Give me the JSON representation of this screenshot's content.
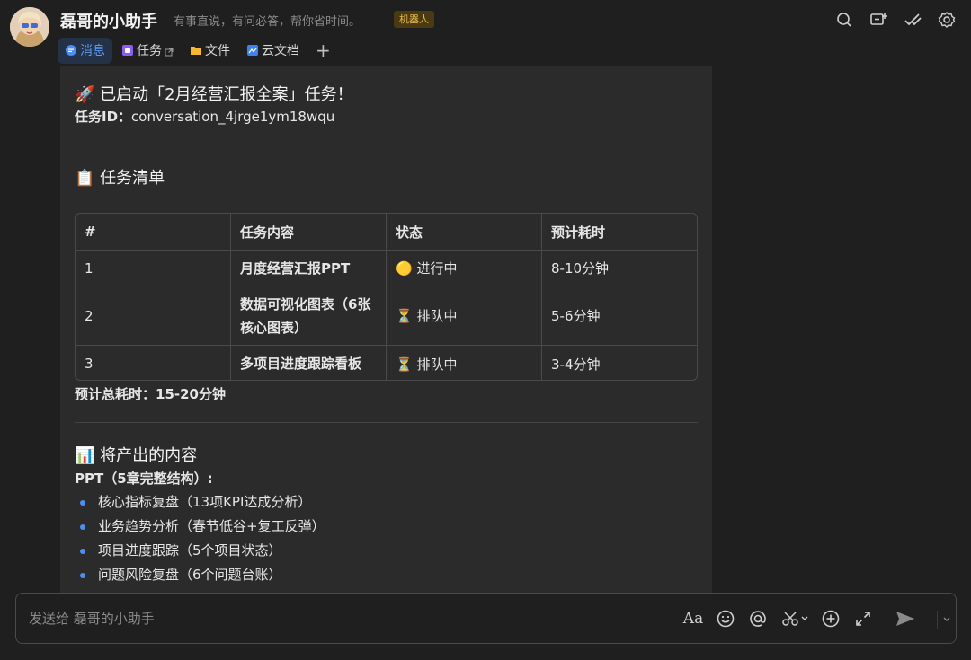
{
  "header": {
    "title": "磊哥的小助手",
    "subtitle": "有事直说，有问必答，帮你省时间。",
    "badge": "机器人",
    "icons": [
      "search-icon",
      "add-chat-icon",
      "check-icon",
      "settings-icon"
    ]
  },
  "tabs": [
    {
      "label": "消息",
      "icon": "message-icon",
      "active": true
    },
    {
      "label": "任务",
      "icon": "task-icon",
      "external": true
    },
    {
      "label": "文件",
      "icon": "folder-icon"
    },
    {
      "label": "云文档",
      "icon": "doc-icon"
    }
  ],
  "message": {
    "launch_title": "🚀 已启动「2月经营汇报全案」任务！",
    "task_id_label": "任务ID：",
    "task_id_value": "conversation_4jrge1ym18wqu",
    "tasklist_title": "📋 任务清单",
    "table": {
      "headers": [
        "#",
        "任务内容",
        "状态",
        "预计耗时"
      ],
      "rows": [
        [
          "1",
          "月度经营汇报PPT",
          "🟡 进行中",
          "8-10分钟"
        ],
        [
          "2",
          "数据可视化图表（6张核心图表）",
          "⏳ 排队中",
          "5-6分钟"
        ],
        [
          "3",
          "多项目进度跟踪看板",
          "⏳ 排队中",
          "3-4分钟"
        ]
      ]
    },
    "total_time": "预计总耗时：15-20分钟",
    "output_title": "📊 将产出的内容",
    "ppt_head": "PPT（5章完整结构）:",
    "bullets": [
      "核心指标复盘（13项KPI达成分析）",
      "业务趋势分析（春节低谷+复工反弹）",
      "项目进度跟踪（5个项目状态）",
      "问题风险复盘（6个问题台账）"
    ]
  },
  "composer": {
    "placeholder": "发送给 磊哥的小助手"
  }
}
